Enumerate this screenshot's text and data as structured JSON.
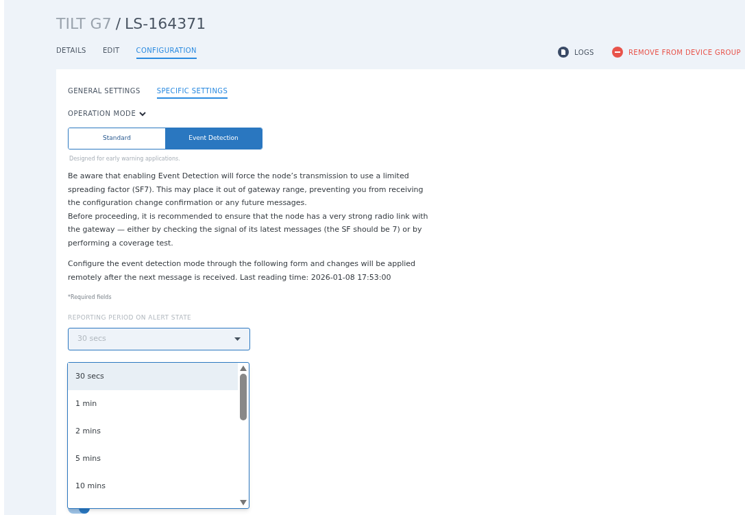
{
  "title": {
    "model": "TILT G7",
    "separator": "/",
    "device": "LS-164371"
  },
  "tabs": [
    {
      "label": "DETAILS",
      "selected": false
    },
    {
      "label": "EDIT",
      "selected": false
    },
    {
      "label": "CONFIGURATION",
      "selected": true
    }
  ],
  "actions": [
    {
      "kind": "logs",
      "label": "LOGS"
    },
    {
      "kind": "remove",
      "label": "REMOVE FROM DEVICE GROUP"
    }
  ],
  "subtabs": [
    {
      "label": "GENERAL SETTINGS",
      "selected": false
    },
    {
      "label": "SPECIFIC SETTINGS",
      "selected": true
    }
  ],
  "operation_mode": {
    "label": "OPERATION MODE",
    "expanded": true,
    "options": [
      {
        "label": "Standard",
        "selected": false
      },
      {
        "label": "Event Detection",
        "selected": true
      }
    ],
    "hint": "Designed for early warning applications."
  },
  "warning": [
    "Be aware that enabling Event Detection will force the node’s transmission to use a limited spreading factor (SF7). This may place it out of gateway range, preventing you from receiving the configuration change confirmation or any future messages.",
    "Before proceeding, it is recommended to ensure that the node has a very strong radio link with the gateway — either by checking the signal of its latest messages (the SF should be 7) or by performing a coverage test."
  ],
  "info": "Configure the event detection mode through the following form and changes will be applied remotely after the next message is received. Last reading time: 2026-01-08 17:53:00",
  "required_note": "*Required fields",
  "reporting_period": {
    "label": "REPORTING PERIOD ON ALERT STATE",
    "value": "30 secs",
    "options": [
      {
        "label": "30 secs",
        "selected": true
      },
      {
        "label": "1 min",
        "selected": false
      },
      {
        "label": "2 mins",
        "selected": false
      },
      {
        "label": "5 mins",
        "selected": false
      },
      {
        "label": "10 mins",
        "selected": false
      }
    ]
  },
  "event_detection_toggle": {
    "on": true
  }
}
